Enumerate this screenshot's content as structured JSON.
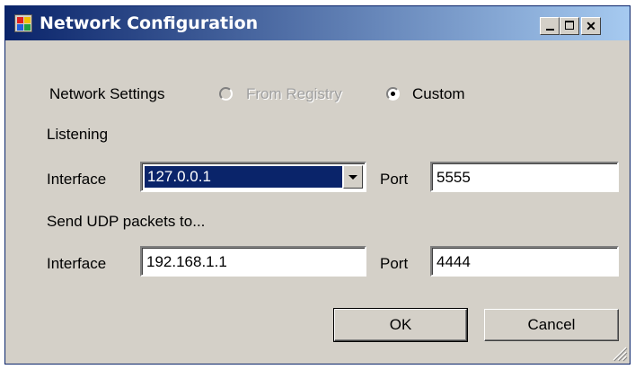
{
  "window": {
    "title": "Network Configuration"
  },
  "network_settings": {
    "label": "Network Settings",
    "option_registry": "From Registry",
    "option_custom": "Custom",
    "selected": "Custom"
  },
  "listening": {
    "heading": "Listening",
    "interface_label": "Interface",
    "interface_value": "127.0.0.1",
    "port_label": "Port",
    "port_value": "5555"
  },
  "send": {
    "heading": "Send UDP packets to...",
    "interface_label": "Interface",
    "interface_value": "192.168.1.1",
    "port_label": "Port",
    "port_value": "4444"
  },
  "buttons": {
    "ok": "OK",
    "cancel": "Cancel"
  },
  "icons": {
    "app": "app-icon",
    "minimize": "minimize-icon",
    "maximize": "maximize-icon",
    "close": "close-icon",
    "dropdown": "chevron-down-icon",
    "resize": "resize-grip-icon"
  },
  "colors": {
    "title_bar": "#0a246a",
    "selection": "#0a246a",
    "face": "#d4d0c8"
  }
}
